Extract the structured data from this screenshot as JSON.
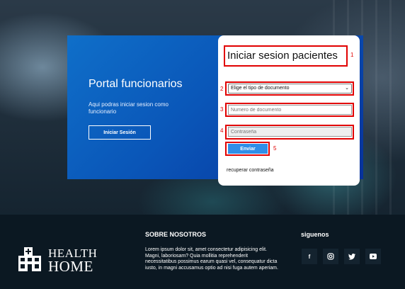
{
  "staff_panel": {
    "title": "Portal funcionarios",
    "description": "Aqui podras iniciar sesion como funcionario",
    "button_label": "Iniciar Sesión"
  },
  "login_card": {
    "title": "Iniciar sesion pacientes",
    "document_type_select": "Elige el tipo de documento",
    "document_number_placeholder": "Numero de documento",
    "password_placeholder": "Contraseña",
    "submit_label": "Enviar",
    "recover_link": "recuperar contraseña"
  },
  "annotations": [
    "1",
    "2",
    "3",
    "4",
    "5"
  ],
  "footer": {
    "logo_line1": "HEALTH",
    "logo_line2": "HOME",
    "about_title": "SOBRE NOSOTROS",
    "about_text": "Lorem ipsum dolor sit, amet consectetur adipisicing elit. Magni, laboriosam? Quia mollitia reprehenderit necessitatibus possimus earum quasi vel, consequatur dicta iusto, in magni accusamus optio ad nisi fuga autem aperiam.",
    "social_title": "siguenos",
    "social_icons": [
      "facebook-icon",
      "instagram-icon",
      "twitter-icon",
      "youtube-icon"
    ]
  },
  "colors": {
    "annotation_red": "#e10000",
    "panel_blue": "#0a56b8",
    "submit_blue": "#2f8ee8",
    "footer_bg": "#0b1822"
  }
}
